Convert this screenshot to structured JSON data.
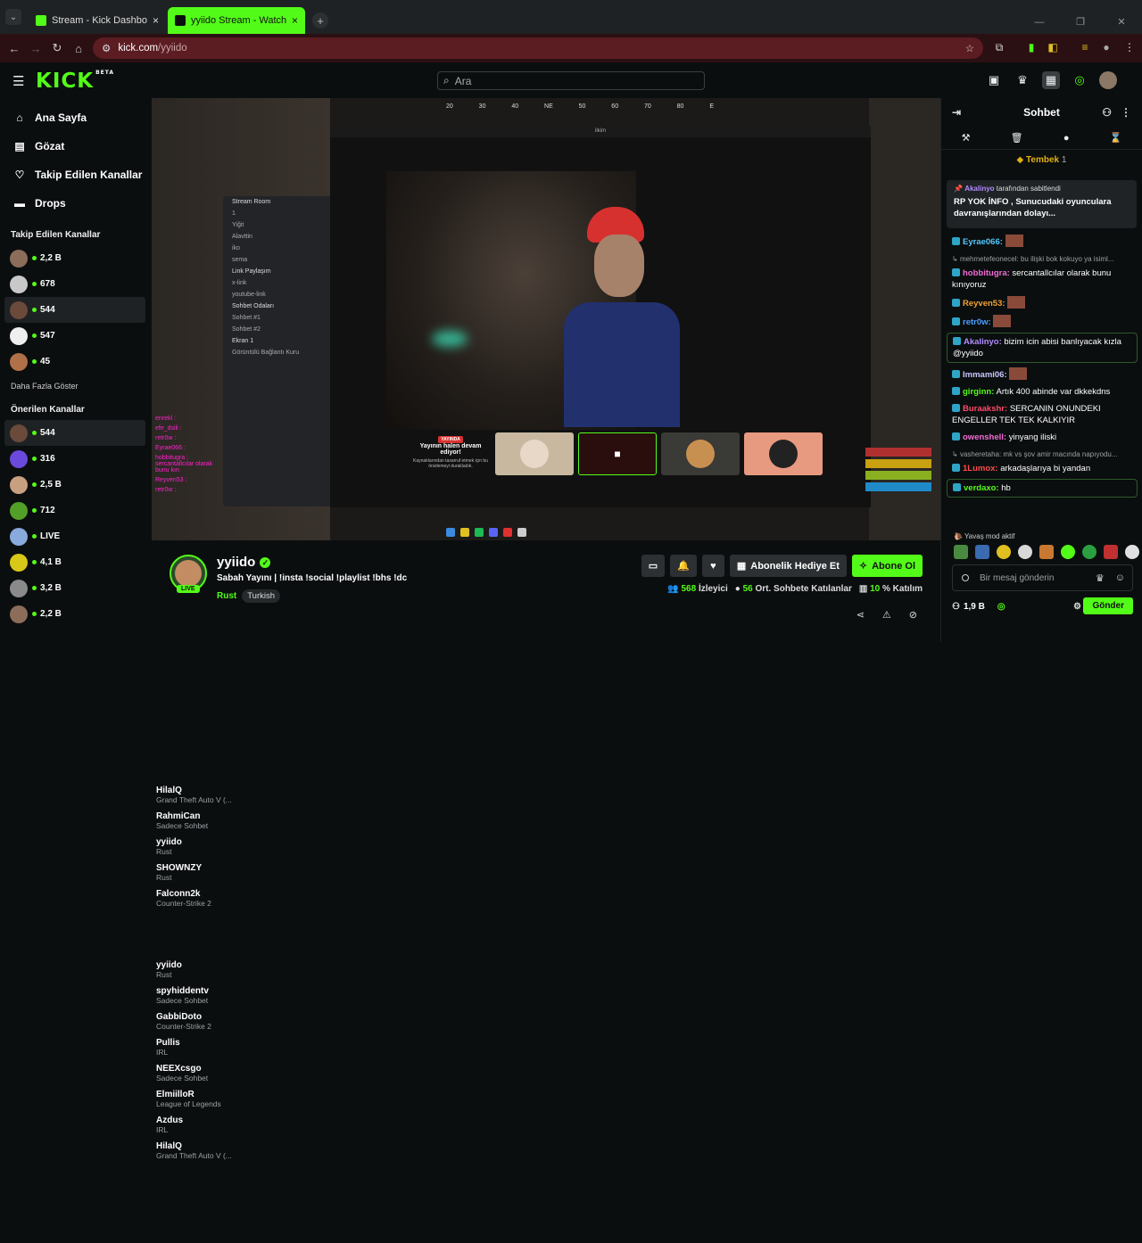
{
  "browser": {
    "tabs": [
      {
        "label": "Stream - Kick Dashboard",
        "active": false
      },
      {
        "label": "yyiido Stream - Watch Live on K",
        "active": true
      }
    ],
    "url_host": "kick.com",
    "url_path": "/yyiido"
  },
  "nav": {
    "logo": "KICK",
    "logo_badge": "BETA",
    "search_placeholder": "Ara"
  },
  "sidebar": {
    "menu": [
      {
        "label": "Ana Sayfa",
        "icon": "home-icon"
      },
      {
        "label": "Gözat",
        "icon": "browse-icon"
      },
      {
        "label": "Takip Edilen Kanallar",
        "icon": "heart-icon"
      },
      {
        "label": "Drops",
        "icon": "drops-icon"
      }
    ],
    "followed_title": "Takip Edilen Kanallar",
    "followed": [
      {
        "name": "HilalQ",
        "category": "Grand Theft Auto V (...",
        "viewers": "2,2 B",
        "color": "#8b6d5a"
      },
      {
        "name": "RahmiCan",
        "category": "Sadece Sohbet",
        "viewers": "678",
        "color": "#c8c8c8"
      },
      {
        "name": "yyiido",
        "category": "Rust",
        "viewers": "544",
        "color": "#6a4a3a"
      },
      {
        "name": "SHOWNZY",
        "category": "Rust",
        "viewers": "547",
        "color": "#eeeeee"
      },
      {
        "name": "Falconn2k",
        "category": "Counter-Strike 2",
        "viewers": "45",
        "color": "#b07048"
      }
    ],
    "show_more": "Daha Fazla Göster",
    "recommended_title": "Önerilen Kanallar",
    "recommended": [
      {
        "name": "yyiido",
        "category": "Rust",
        "viewers": "544",
        "color": "#6a4a3a"
      },
      {
        "name": "spyhiddentv",
        "category": "Sadece Sohbet",
        "viewers": "316",
        "color": "#6a4adc"
      },
      {
        "name": "GabbiDoto",
        "category": "Counter-Strike 2",
        "viewers": "2,5 B",
        "color": "#c8a080"
      },
      {
        "name": "Pullis",
        "category": "IRL",
        "viewers": "712",
        "color": "#53a028"
      },
      {
        "name": "NEEXcsgo",
        "category": "Sadece Sohbet",
        "viewers": "LIVE",
        "color": "#88aadd"
      },
      {
        "name": "ElmiilloR",
        "category": "League of Legends",
        "viewers": "4,1 B",
        "color": "#d8c818"
      },
      {
        "name": "Azdus",
        "category": "IRL",
        "viewers": "3,2 B",
        "color": "#8a8a8a"
      },
      {
        "name": "HilalQ",
        "category": "Grand Theft Auto V (...",
        "viewers": "2,2 B",
        "color": "#8b6d5a"
      }
    ]
  },
  "player": {
    "ruler_ticks": [
      "20",
      "30",
      "40",
      "NE",
      "50",
      "60",
      "70",
      "80",
      "E"
    ],
    "discord_rows": [
      "Stream Room",
      "1",
      "Yiğit",
      "Alavttin",
      "iko",
      "sema",
      "Link Paylaşım",
      "x-link",
      "youtube-link",
      "Sohbet Odaları",
      "Sohbet #1",
      "Sohbet #2",
      "Ekran 1",
      "Görüntülü Bağlantı Kuru"
    ],
    "window_title": "ilkim",
    "paused_label": "YAYINDA",
    "paused_text": "Yayının halen devam ediyor!",
    "paused_sub": "Kaynaklarından tasarruf etmek için bu önizlemeyi durakladık.",
    "overlay_chat": [
      "enrekl :",
      "efe_dsili :",
      "retr0w :",
      "Eyrae066 :",
      "hobbitugra : sercantallcılar olarak bunu kın",
      "Reyven53 :",
      "retr0w :"
    ]
  },
  "stream": {
    "streamer": "yyiido",
    "live": "LIVE",
    "title": "Sabah Yayını | !insta !social !playlist !bhs !dc",
    "category": "Rust",
    "tag": "Turkish",
    "gift_label": "Abonelik Hediye Et",
    "subscribe_label": "Abone Ol",
    "viewers": "568",
    "viewers_label": "İzleyici",
    "avg_chatters": "56",
    "avg_chatters_label": "Ort. Sohbete Katılanlar",
    "participation": "10",
    "participation_label": "% Katılım"
  },
  "chat": {
    "title": "Sohbet",
    "idle_label": "Tembek",
    "idle_count": "1",
    "pinned_by": "Akalinyo",
    "pinned_suffix": "tarafından sabitlendi",
    "pinned_msg": "RP YOK  İNFO , Sunucudaki oyunculara davranışlarından dolayı...",
    "messages": [
      {
        "user": "Eyrae066:",
        "text": "",
        "color": "#53c8ff",
        "emote": true
      },
      {
        "reply": "mehmetefeonecel: bu ilişki bok kokuyo ya isiml..."
      },
      {
        "user": "hobbitugra:",
        "text": "sercantallcılar olarak bunu kınıyoruz",
        "color": "#f06cd5"
      },
      {
        "user": "Reyven53:",
        "text": "",
        "color": "#f0a030",
        "emote": true
      },
      {
        "user": "retr0w:",
        "text": "",
        "color": "#4aa0ff",
        "emote": true
      },
      {
        "user": "Akalinyo:",
        "text": "bizim icin abisi banlıyacak kızla @yyiido",
        "color": "#b38cff",
        "hl": true
      },
      {
        "user": "Immami06:",
        "text": "",
        "color": "#c8c8ff",
        "emote": true
      },
      {
        "user": "girginn:",
        "text": "Artık 400 abinde var dkkekdns",
        "color": "#53fc18"
      },
      {
        "user": "Buraakshr:",
        "text": "SERCANIN ONUNDEKI ENGELLER TEK TEK KALKIYIR",
        "color": "#ff4a6a"
      },
      {
        "user": "owenshell:",
        "text": "yinyang iliski",
        "color": "#f06cd5"
      },
      {
        "reply": "vasheretaha: mk vs şov amir macında napıyodu..."
      },
      {
        "user": "1Lumox:",
        "text": "arkadaşlarıya bi yandan",
        "color": "#ff4a4a"
      },
      {
        "user": "verdaxo:",
        "text": "hb",
        "color": "#53fc18",
        "hl": true
      }
    ],
    "slow_mode": "Yavaş mod aktif",
    "input_placeholder": "Bir mesaj gönderin",
    "followers": "1,9 B",
    "send_label": "Gönder"
  }
}
